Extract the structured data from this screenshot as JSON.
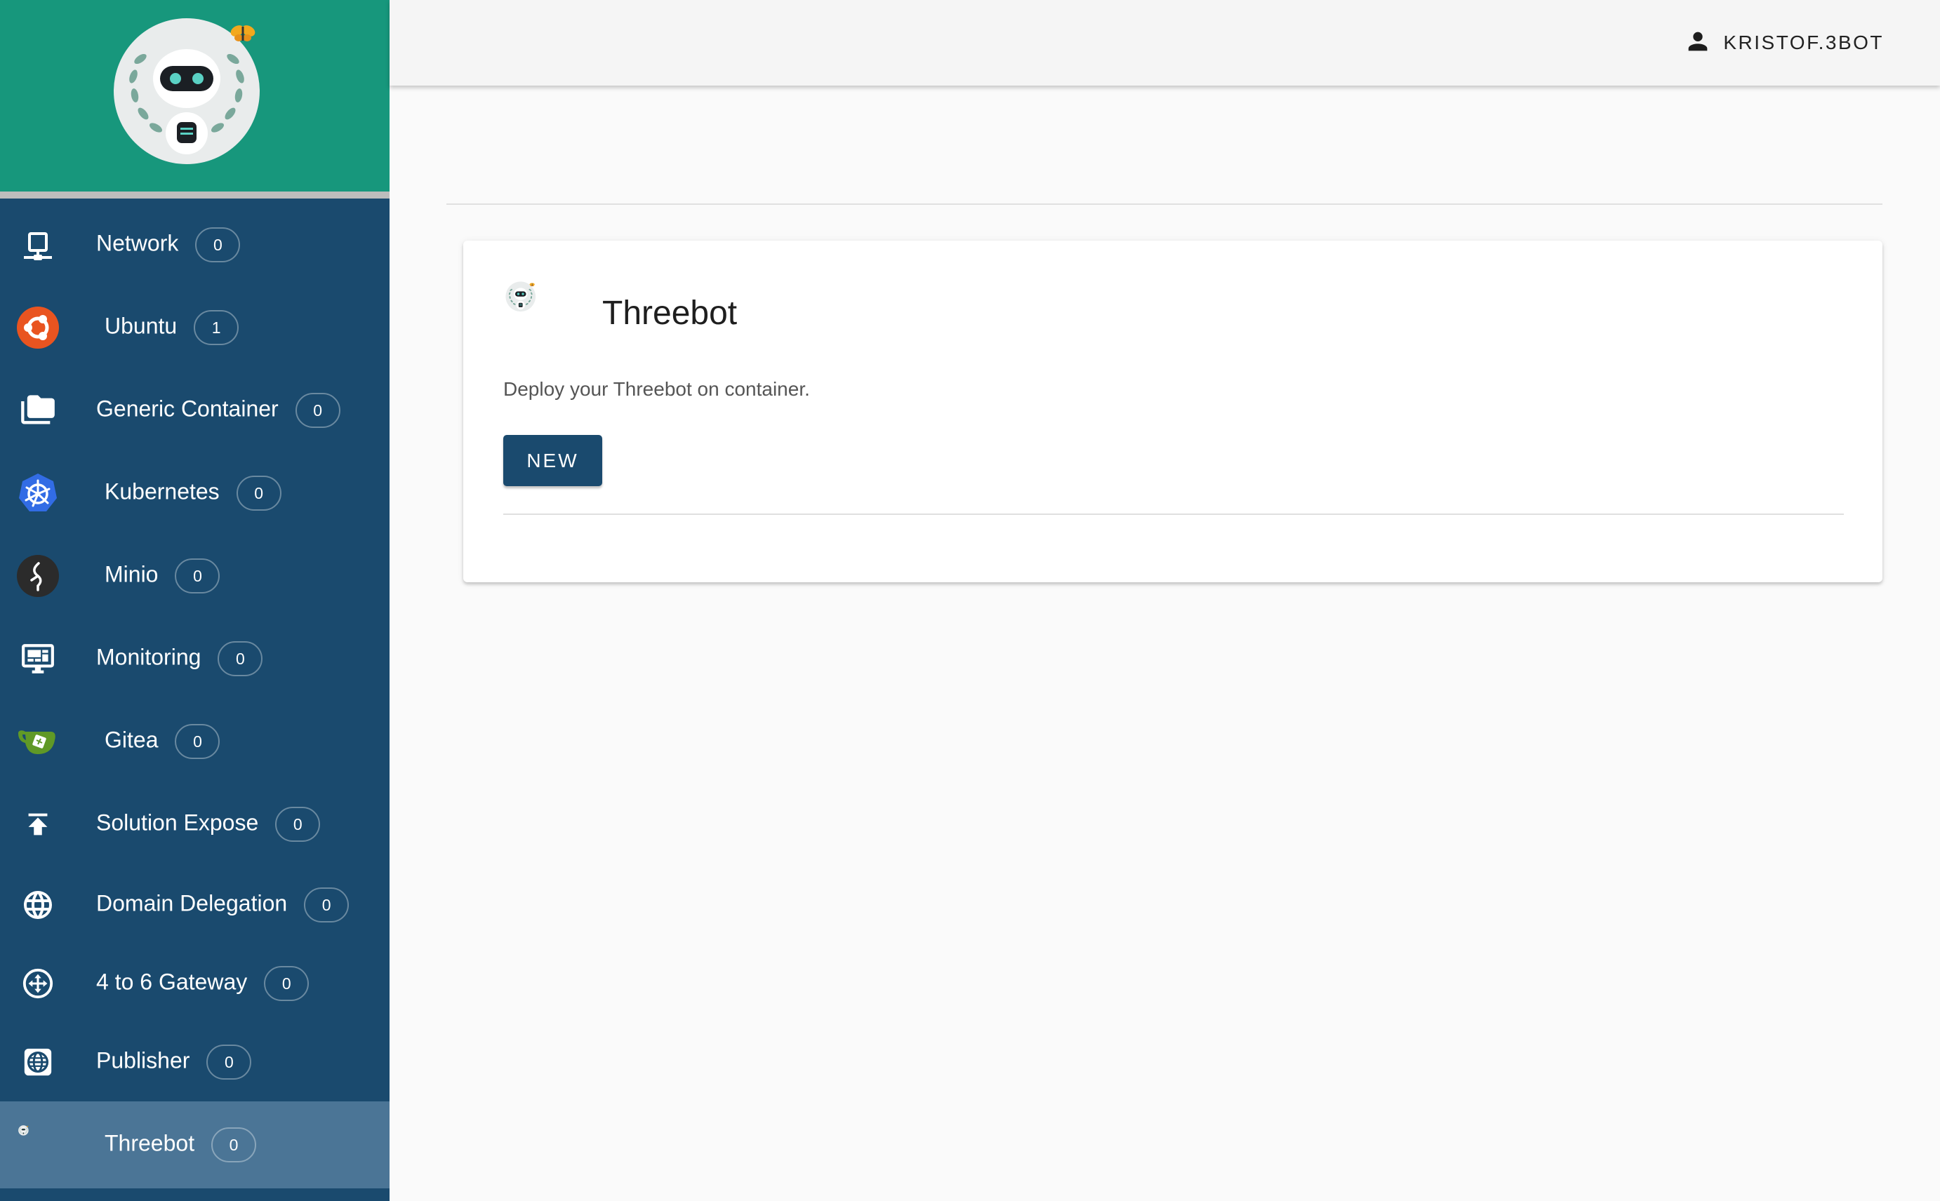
{
  "sidebar": {
    "items": [
      {
        "label": "Network",
        "count": "0",
        "icon": "network-icon"
      },
      {
        "label": "Ubuntu",
        "count": "1",
        "icon": "ubuntu-icon"
      },
      {
        "label": "Generic Container",
        "count": "0",
        "icon": "folder-icon"
      },
      {
        "label": "Kubernetes",
        "count": "0",
        "icon": "kubernetes-icon"
      },
      {
        "label": "Minio",
        "count": "0",
        "icon": "minio-icon"
      },
      {
        "label": "Monitoring",
        "count": "0",
        "icon": "monitor-icon"
      },
      {
        "label": "Gitea",
        "count": "0",
        "icon": "gitea-icon"
      },
      {
        "label": "Solution Expose",
        "count": "0",
        "icon": "upload-icon"
      },
      {
        "label": "Domain Delegation",
        "count": "0",
        "icon": "globe-icon"
      },
      {
        "label": "4 to 6 Gateway",
        "count": "0",
        "icon": "gateway-icon"
      },
      {
        "label": "Publisher",
        "count": "0",
        "icon": "publisher-icon"
      },
      {
        "label": "Threebot",
        "count": "0",
        "icon": "threebot-icon",
        "active": true
      }
    ]
  },
  "topbar": {
    "username": "KRISTOF.3BOT",
    "user_icon": "person-icon"
  },
  "card": {
    "title": "Threebot",
    "description": "Deploy your Threebot on container.",
    "button_label": "NEW"
  },
  "colors": {
    "sidebar_bg": "#1a4a6e",
    "header_bg": "#17977c",
    "active_bg": "#4b7596",
    "button_bg": "#1a4a6e"
  }
}
